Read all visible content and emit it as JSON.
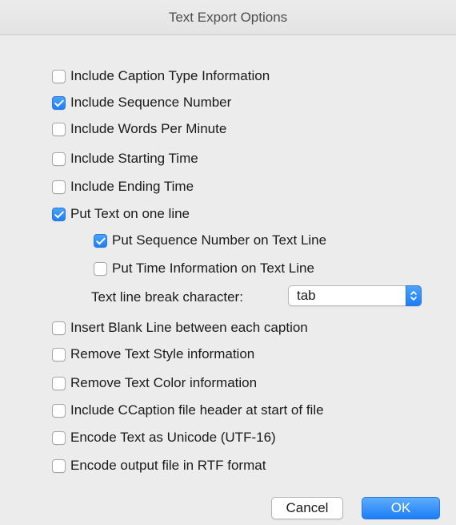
{
  "dialog": {
    "title": "Text Export Options"
  },
  "options": [
    {
      "label": "Include Caption Type Information",
      "checked": false
    },
    {
      "label": "Include Sequence Number",
      "checked": true
    },
    {
      "label": "Include Words Per Minute",
      "checked": false
    },
    {
      "label": "Include Starting Time",
      "checked": false
    },
    {
      "label": "Include Ending Time",
      "checked": false
    },
    {
      "label": "Put Text on one line",
      "checked": true
    },
    {
      "label": "Put Sequence Number on Text Line",
      "checked": true
    },
    {
      "label": "Put Time Information on Text Line",
      "checked": false
    },
    {
      "label": "Insert Blank Line between each caption",
      "checked": false
    },
    {
      "label": "Remove Text Style information",
      "checked": false
    },
    {
      "label": "Remove Text Color information",
      "checked": false
    },
    {
      "label": "Include CCaption file header at start of file",
      "checked": false
    },
    {
      "label": "Encode Text as Unicode (UTF-16)",
      "checked": false
    },
    {
      "label": "Encode output file in RTF format",
      "checked": false
    }
  ],
  "line_break": {
    "label": "Text line break character:",
    "value": "tab"
  },
  "buttons": {
    "cancel": "Cancel",
    "ok": "OK"
  },
  "colors": {
    "accent": "#1e7ef6",
    "background": "#ececec"
  }
}
